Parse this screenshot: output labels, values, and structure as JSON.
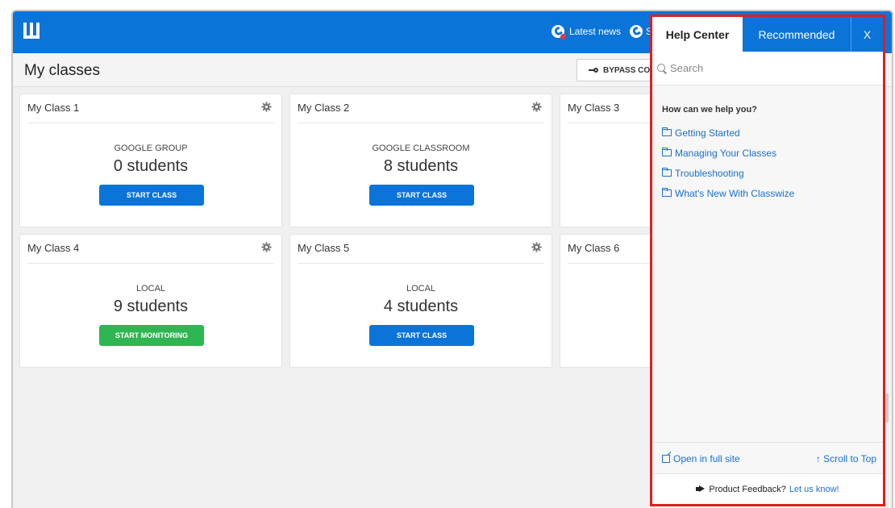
{
  "topbar": {
    "news_label": "Latest news",
    "second_label": "S"
  },
  "header": {
    "title": "My classes",
    "bypass_label": "BYPASS COD"
  },
  "classes": [
    {
      "name": "My Class 1",
      "type": "GOOGLE GROUP",
      "count": "0 students",
      "button": "START CLASS",
      "button_color": "#0a74d8"
    },
    {
      "name": "My Class 2",
      "type": "GOOGLE CLASSROOM",
      "count": "8 students",
      "button": "START CLASS",
      "button_color": "#0a74d8"
    },
    {
      "name": "My Class 3",
      "type": "",
      "count": "",
      "button": "",
      "button_color": "#0a74d8"
    },
    {
      "name": "My Class 4",
      "type": "LOCAL",
      "count": "9 students",
      "button": "START MONITORING",
      "button_color": "#2fb552"
    },
    {
      "name": "My Class 5",
      "type": "LOCAL",
      "count": "4 students",
      "button": "START CLASS",
      "button_color": "#0a74d8"
    },
    {
      "name": "My Class 6",
      "type": "",
      "count": "",
      "button": "",
      "button_color": "#0a74d8"
    }
  ],
  "help": {
    "tabs": {
      "help_center": "Help Center",
      "recommended": "Recommended",
      "close": "X"
    },
    "search_placeholder": "Search",
    "heading": "How can we help you?",
    "items": [
      "Getting Started",
      "Managing Your Classes",
      "Troubleshooting",
      "What's New With Classwize"
    ],
    "open_full": "Open in full site",
    "scroll_top": "↑ Scroll to Top",
    "feedback_text": "Product Feedback?",
    "feedback_link": "Let us know!"
  },
  "colors": {
    "brand_blue": "#0a74d8",
    "start_green": "#2fb552",
    "highlight_red": "#e01e1e"
  }
}
